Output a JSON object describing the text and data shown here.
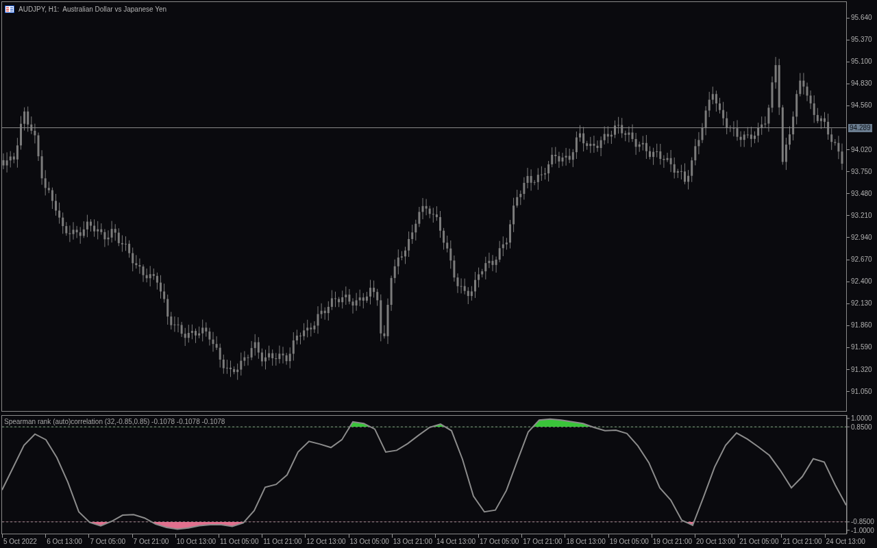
{
  "title": "AUDJPY, H1:  Australian Dollar vs Japanese Yen",
  "price_axis": {
    "labels": [
      "95.640",
      "95.370",
      "95.100",
      "94.830",
      "94.560",
      "94.020",
      "93.750",
      "93.480",
      "93.210",
      "92.940",
      "92.670",
      "92.400",
      "92.130",
      "91.860",
      "91.590",
      "91.320",
      "91.050"
    ],
    "current_price": "94.289"
  },
  "indicator": {
    "label": "Spearman rank (auto)correlation (32,-0.85,0.85) -0.1078 -0.1078 -0.1078",
    "chart_data": {
      "type": "line",
      "ylim": [
        -1.06,
        1.06
      ],
      "yticks": [
        {
          "value": 1,
          "label": "1.0000"
        },
        {
          "value": 0.85,
          "label": "0.8500"
        },
        {
          "value": -0.85,
          "label": "-0.8500"
        },
        {
          "value": -1,
          "label": "-1.0000"
        }
      ],
      "categories": [
        null,
        null,
        null,
        null,
        null,
        null,
        null,
        null,
        null,
        null,
        null,
        null,
        null,
        null,
        null,
        null,
        null,
        null,
        null,
        null,
        null,
        null,
        null,
        null,
        null,
        null,
        null,
        null,
        null,
        null,
        null,
        null,
        null,
        null,
        null,
        null,
        null,
        null,
        null,
        null,
        null,
        null,
        null,
        null,
        null,
        null,
        null,
        null,
        null,
        null,
        null,
        null,
        null,
        null,
        null,
        null,
        null,
        null,
        null,
        null,
        null,
        null,
        null,
        null,
        null,
        null,
        null,
        null,
        null,
        null,
        null,
        null,
        null,
        null,
        null,
        null,
        null,
        null
      ],
      "series": [
        {
          "color": "#8c8c8c",
          "values": [
            -0.28,
            0.12,
            0.52,
            0.72,
            0.62,
            0.3,
            -0.14,
            -0.67,
            -0.86,
            -0.92,
            -0.84,
            -0.73,
            -0.72,
            -0.78,
            -0.89,
            -0.95,
            -0.98,
            -0.96,
            -0.92,
            -0.9,
            -0.9,
            -0.93,
            -0.87,
            -0.65,
            -0.23,
            -0.18,
            -0.01,
            0.4,
            0.59,
            0.54,
            0.48,
            0.62,
            0.94,
            0.91,
            0.81,
            0.4,
            0.43,
            0.55,
            0.7,
            0.84,
            0.9,
            0.78,
            0.27,
            -0.39,
            -0.67,
            -0.64,
            -0.29,
            0.24,
            0.76,
            0.97,
            0.99,
            0.97,
            0.94,
            0.91,
            0.84,
            0.78,
            0.79,
            0.73,
            0.51,
            0.21,
            -0.24,
            -0.46,
            -0.82,
            -0.91,
            -0.4,
            0.13,
            0.52,
            0.74,
            0.63,
            0.49,
            0.34,
            0.07,
            -0.24,
            -0.04,
            0.28,
            0.22,
            -0.19,
            -0.55
          ]
        }
      ]
    }
  },
  "time_axis": {
    "labels": [
      "5 Oct 2022",
      "6 Oct 13:00",
      "7 Oct 05:00",
      "7 Oct 21:00",
      "10 Oct 13:00",
      "11 Oct 05:00",
      "11 Oct 21:00",
      "12 Oct 13:00",
      "13 Oct 05:00",
      "13 Oct 21:00",
      "14 Oct 13:00",
      "17 Oct 05:00",
      "17 Oct 21:00",
      "18 Oct 13:00",
      "19 Oct 05:00",
      "19 Oct 21:00",
      "20 Oct 13:00",
      "21 Oct 05:00",
      "21 Oct 21:00",
      "24 Oct 13:00"
    ]
  }
}
